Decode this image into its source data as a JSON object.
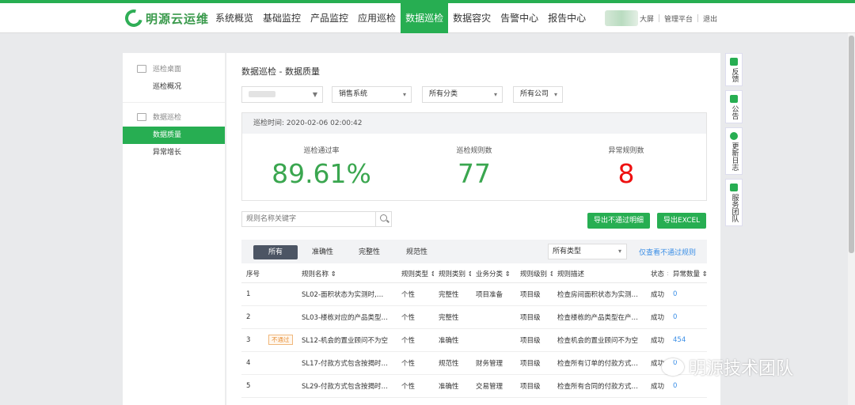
{
  "header": {
    "logo_text": "明源云运维",
    "nav": [
      "系统概览",
      "基础监控",
      "产品监控",
      "应用巡检",
      "数据巡检",
      "数据容灾",
      "告警中心",
      "报告中心"
    ],
    "active_nav": "数据巡检",
    "links": [
      "大屏",
      "管理平台",
      "退出"
    ]
  },
  "sidebar": {
    "group1": "巡检桌面",
    "item1": "巡检概况",
    "group2": "数据巡检",
    "item2": "数据质量",
    "item3": "异常增长"
  },
  "main": {
    "title": "数据巡检 - 数据质量",
    "filters": {
      "system": "销售系统",
      "category": "所有分类",
      "company": "所有公司"
    },
    "inspect_time_label": "巡检时间:",
    "inspect_time": "2020-02-06 02:00:42",
    "stats": {
      "pass_rate_label": "巡检通过率",
      "pass_rate": "89.61%",
      "rule_count_label": "巡检规则数",
      "rule_count": "77",
      "abnormal_label": "异常规则数",
      "abnormal_count": "8"
    },
    "search_placeholder": "规则名称关键字",
    "export_fail_btn": "导出不通过明细",
    "export_excel_btn": "导出EXCEL",
    "tabs": [
      "所有",
      "准确性",
      "完整性",
      "规范性"
    ],
    "type_select": "所有类型",
    "only_fail_link": "仅查看不通过规则",
    "table": {
      "headers": [
        "序号",
        "规则名称",
        "规则类型",
        "规则类别",
        "业务分类",
        "规则级别",
        "规则描述",
        "状态",
        "异常数量"
      ],
      "rows": [
        {
          "no": "1",
          "tag": "",
          "name": "SL02-面积状态为实测时,…",
          "type": "个性",
          "category": "完整性",
          "biz": "项目准备",
          "level": "项目级",
          "desc": "检查房间面积状态为实测…",
          "status": "成功",
          "count": "0"
        },
        {
          "no": "2",
          "tag": "",
          "name": "SL03-楼栋对应的产品类型…",
          "type": "个性",
          "category": "完整性",
          "biz": "",
          "level": "项目级",
          "desc": "检查楼栋的产品类型在产…",
          "status": "成功",
          "count": "0"
        },
        {
          "no": "3",
          "tag": "不通过",
          "name": "SL12-机会的置业顾问不为空",
          "type": "个性",
          "category": "准确性",
          "biz": "",
          "level": "项目级",
          "desc": "检查机会的置业顾问不为空",
          "status": "成功",
          "count": "454"
        },
        {
          "no": "4",
          "tag": "",
          "name": "SL17-付款方式包含按揭时…",
          "type": "个性",
          "category": "规范性",
          "biz": "财务管理",
          "level": "项目级",
          "desc": "检查所有订单的付款方式…",
          "status": "成功",
          "count": "0"
        },
        {
          "no": "5",
          "tag": "",
          "name": "SL29-付款方式包含按揭时…",
          "type": "个性",
          "category": "准确性",
          "biz": "交易管理",
          "level": "项目级",
          "desc": "检查所有合同的付款方式…",
          "status": "成功",
          "count": "0"
        }
      ]
    }
  },
  "right_tools": [
    "反馈",
    "公告",
    "更新日志",
    "服务团队"
  ],
  "watermark": "明源技术团队",
  "colors": {
    "brand_green": "#27ae52",
    "value_green": "#3aa64f",
    "value_red": "#ee1111",
    "link_blue": "#3a8ee6"
  }
}
